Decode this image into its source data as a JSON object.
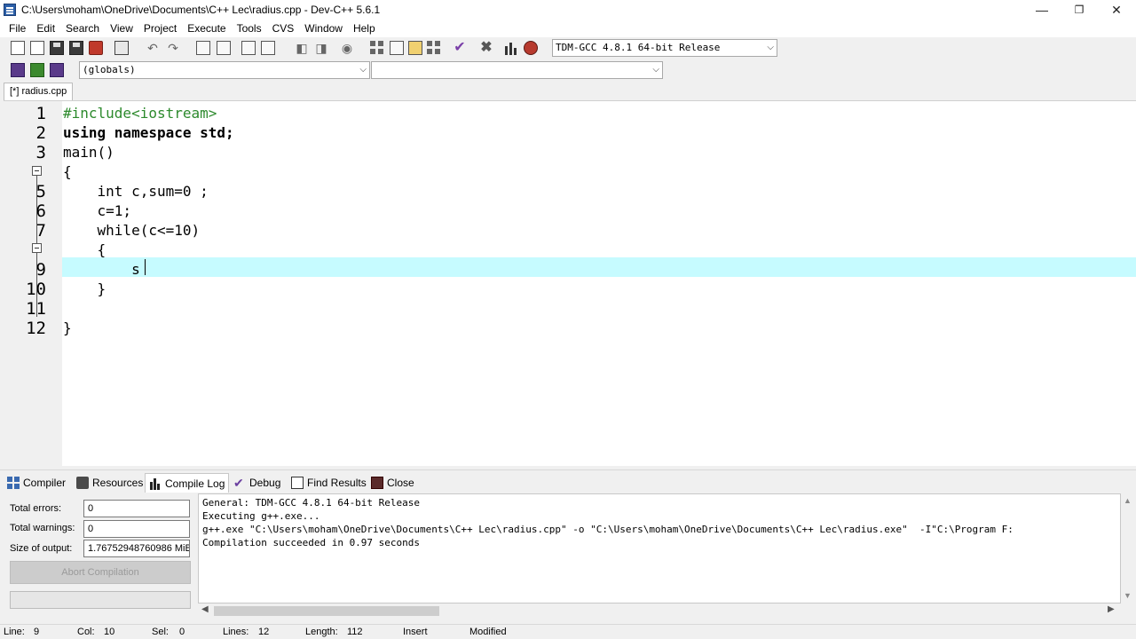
{
  "window": {
    "title": "C:\\Users\\moham\\OneDrive\\Documents\\C++ Lec\\radius.cpp - Dev-C++ 5.6.1",
    "minimize": "—",
    "maximize": "❐",
    "close": "✕"
  },
  "menu": [
    "File",
    "Edit",
    "Search",
    "View",
    "Project",
    "Execute",
    "Tools",
    "CVS",
    "Window",
    "Help"
  ],
  "toolbar": {
    "compiler_select": "TDM-GCC 4.8.1 64-bit Release",
    "scope_select": "(globals)",
    "member_select": ""
  },
  "file_tab": "[*] radius.cpp",
  "editor": {
    "line_numbers": [
      "1",
      "2",
      "3",
      "4",
      "5",
      "6",
      "7",
      "8",
      "9",
      "10",
      "11",
      "12"
    ],
    "lines": [
      "#include<iostream>",
      "using namespace std;",
      "main()",
      "{",
      "    int c,sum=0 ;",
      "    c=1;",
      "    while(c<=10)",
      "    {",
      "        s",
      "    }",
      "",
      "}"
    ]
  },
  "bottom_tabs": [
    "Compiler",
    "Resources",
    "Compile Log",
    "Debug",
    "Find Results",
    "Close"
  ],
  "compile_panel": {
    "total_errors_label": "Total errors:",
    "total_errors": "0",
    "total_warnings_label": "Total warnings:",
    "total_warnings": "0",
    "size_label": "Size of output:",
    "size": "1.76752948760986 MiB",
    "abort_button": "Abort Compilation"
  },
  "log": [
    "General: TDM-GCC 4.8.1 64-bit Release",
    "Executing g++.exe...",
    "g++.exe \"C:\\Users\\moham\\OneDrive\\Documents\\C++ Lec\\radius.cpp\" -o \"C:\\Users\\moham\\OneDrive\\Documents\\C++ Lec\\radius.exe\"  -I\"C:\\Program F:",
    "Compilation succeeded in 0.97 seconds"
  ],
  "status": {
    "line_label": "Line:",
    "line": "9",
    "col_label": "Col:",
    "col": "10",
    "sel_label": "Sel:",
    "sel": "0",
    "lines_label": "Lines:",
    "lines": "12",
    "length_label": "Length:",
    "length": "112",
    "mode": "Insert",
    "modified": "Modified"
  }
}
